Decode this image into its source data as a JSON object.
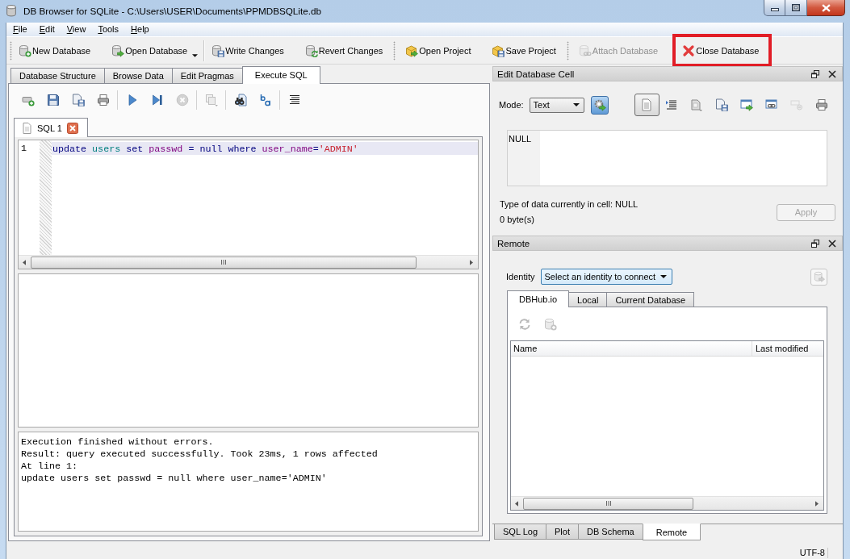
{
  "window": {
    "title": "DB Browser for SQLite - C:\\Users\\USER\\Documents\\PPMDBSQLite.db"
  },
  "menu": [
    {
      "label": "File"
    },
    {
      "label": "Edit"
    },
    {
      "label": "View"
    },
    {
      "label": "Tools"
    },
    {
      "label": "Help"
    }
  ],
  "toolbar": {
    "groups": [
      {
        "items": [
          {
            "label": "New Database",
            "disabled": false,
            "dropdown": false,
            "highlighted": false
          },
          {
            "label": "Open Database",
            "disabled": false,
            "dropdown": true,
            "highlighted": false
          }
        ]
      },
      {
        "items": [
          {
            "label": "Write Changes",
            "disabled": false,
            "dropdown": false,
            "highlighted": false
          },
          {
            "label": "Revert Changes",
            "disabled": false,
            "dropdown": false,
            "highlighted": false
          }
        ]
      },
      {
        "items": [
          {
            "label": "Open Project",
            "disabled": false,
            "dropdown": false,
            "highlighted": false
          },
          {
            "label": "Save Project",
            "disabled": false,
            "dropdown": false,
            "highlighted": false
          }
        ]
      },
      {
        "items": [
          {
            "label": "Attach Database",
            "disabled": true,
            "dropdown": false,
            "highlighted": false
          },
          {
            "label": "Close Database",
            "disabled": false,
            "dropdown": false,
            "highlighted": true
          }
        ]
      }
    ]
  },
  "main_tabs": [
    {
      "label": "Database Structure",
      "selected": false
    },
    {
      "label": "Browse Data",
      "selected": false
    },
    {
      "label": "Edit Pragmas",
      "selected": false
    },
    {
      "label": "Execute SQL",
      "selected": true
    }
  ],
  "sql_toolbar": [
    {
      "disabled": false
    },
    {
      "disabled": false
    },
    {
      "disabled": false
    },
    {
      "disabled": false
    },
    {
      "disabled": false
    },
    {
      "disabled": false
    },
    {
      "disabled": true
    },
    {
      "disabled": true
    },
    {
      "disabled": false
    },
    {
      "disabled": false
    },
    {
      "disabled": false
    }
  ],
  "editor_tabs": [
    {
      "label": "SQL 1",
      "selected": true
    }
  ],
  "editor": {
    "lines": [
      {
        "number": "1",
        "current": true,
        "tokens": [
          {
            "text": "update ",
            "kind": "keyword"
          },
          {
            "text": "users ",
            "kind": "table"
          },
          {
            "text": "set ",
            "kind": "keyword"
          },
          {
            "text": "passwd ",
            "kind": "column"
          },
          {
            "text": "= ",
            "kind": "operator"
          },
          {
            "text": "null ",
            "kind": "keyword"
          },
          {
            "text": "where ",
            "kind": "keyword"
          },
          {
            "text": "user_name",
            "kind": "column"
          },
          {
            "text": "=",
            "kind": "operator"
          },
          {
            "text": "'ADMIN'",
            "kind": "string"
          }
        ]
      }
    ]
  },
  "message_log": {
    "lines": [
      "Execution finished without errors.",
      "Result: query executed successfully. Took 23ms, 1 rows affected",
      "At line 1:",
      "update users set passwd = null where user_name='ADMIN'"
    ]
  },
  "edit_cell_panel": {
    "title": "Edit Database Cell",
    "mode_label": "Mode:",
    "mode": {
      "value": "Text"
    },
    "tool_buttons": [
      {
        "selected": true,
        "disabled": false
      },
      {
        "selected": false,
        "disabled": false
      },
      {
        "selected": false,
        "disabled": false
      },
      {
        "selected": false,
        "disabled": false
      },
      {
        "selected": false,
        "disabled": false
      },
      {
        "selected": false,
        "disabled": false
      },
      {
        "selected": false,
        "disabled": true
      },
      {
        "selected": false,
        "disabled": false
      }
    ],
    "cell_editor": {
      "placeholder": "NULL"
    },
    "type_info": "Type of data currently in cell: NULL",
    "size_info": "0 byte(s)",
    "apply_button": {
      "label": "Apply",
      "disabled": true
    }
  },
  "remote_panel": {
    "title": "Remote",
    "identity_label": "Identity",
    "identity": {
      "value": "Select an identity to connect"
    },
    "push_button": {
      "disabled": true
    },
    "tabs": [
      {
        "label": "DBHub.io",
        "selected": true
      },
      {
        "label": "Local",
        "selected": false
      },
      {
        "label": "Current Database",
        "selected": false
      }
    ],
    "tool_buttons": [
      {
        "disabled": true
      },
      {
        "disabled": true
      }
    ],
    "table": {
      "columns": [
        "Name",
        "Last modified"
      ]
    }
  },
  "dock_tabs": [
    {
      "label": "SQL Log",
      "selected": false
    },
    {
      "label": "Plot",
      "selected": false
    },
    {
      "label": "DB Schema",
      "selected": false
    },
    {
      "label": "Remote",
      "selected": true
    }
  ],
  "status_bar": {
    "encoding": "UTF-8"
  }
}
